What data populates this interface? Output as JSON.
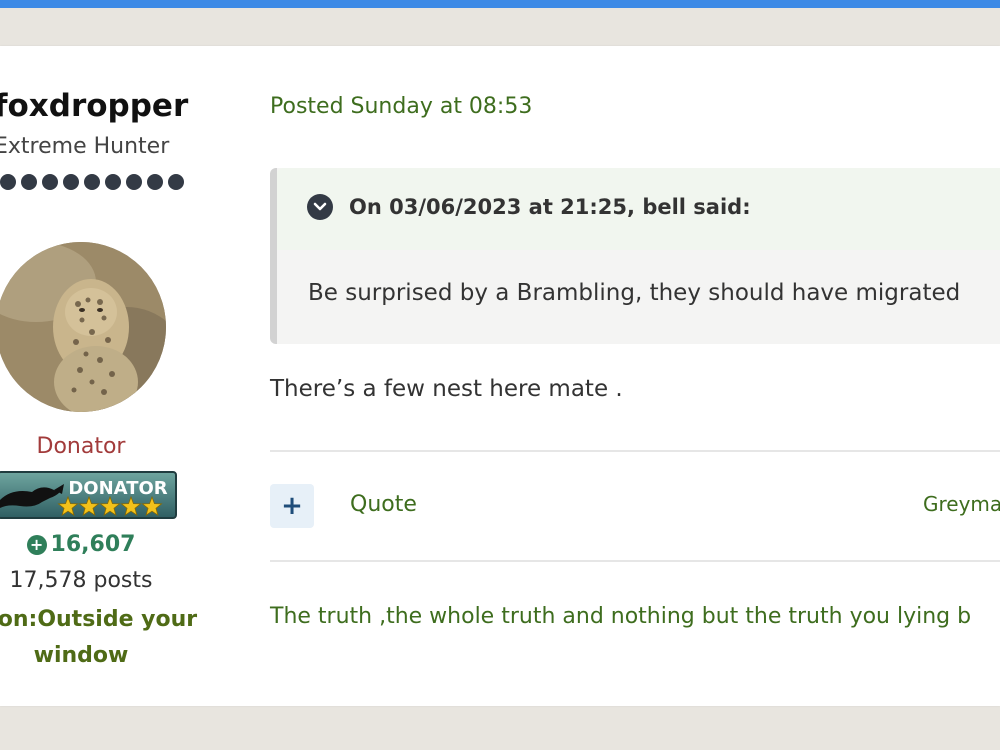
{
  "author": {
    "name": "foxdropper",
    "rank": "Extreme Hunter",
    "pip_count": 9,
    "group": "Donator",
    "badge_text": "DONATOR",
    "badge_stars": 5,
    "reputation": "16,607",
    "posts": "17,578 posts",
    "location_line1": "ation:Outside your",
    "location_line2": "window"
  },
  "post": {
    "date": "Posted Sunday at 08:53",
    "quote": {
      "citation": "On 03/06/2023 at 21:25, bell said:",
      "text": "Be surprised by a Brambling, they should have migrated"
    },
    "body": "There’s a few nest here mate .",
    "actions": {
      "plus_label": "+",
      "quote_label": "Quote",
      "liked_by": "Greyma"
    },
    "signature": "The truth ,the whole truth and nothing but the truth you lying b"
  },
  "colors": {
    "accent_bar": "#3d8ae6",
    "post_green": "#3e6d1e",
    "donator_red": "#a23b3b",
    "reputation_green": "#2f7f5a",
    "location_olive": "#4f6b16"
  }
}
